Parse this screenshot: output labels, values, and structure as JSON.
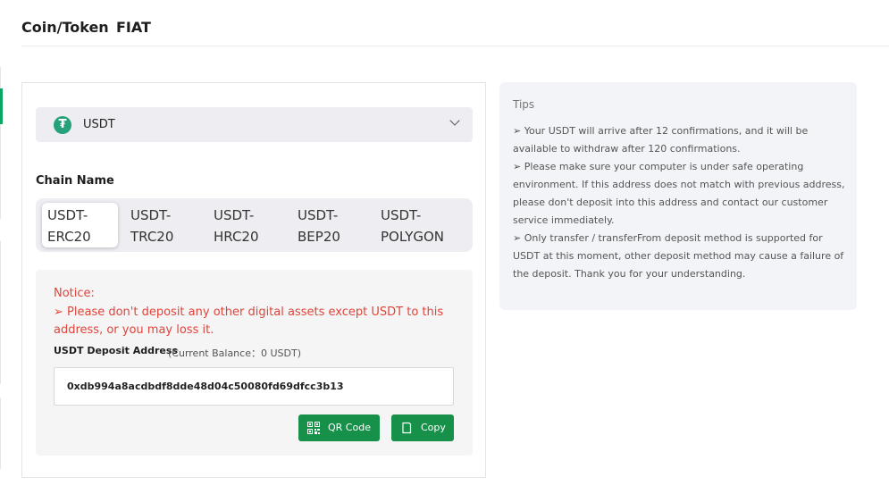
{
  "tabs": {
    "coin": "Coin/Token",
    "fiat": "FIAT"
  },
  "coin": {
    "name": "USDT",
    "icon": "tether-icon",
    "icon_glyph": "₮",
    "icon_color": "#26a17b"
  },
  "chain": {
    "label": "Chain Name",
    "options": [
      {
        "line1": "USDT-",
        "line2": "ERC20"
      },
      {
        "line1": "USDT-",
        "line2": "TRC20"
      },
      {
        "line1": "USDT-",
        "line2": "HRC20"
      },
      {
        "line1": "USDT-",
        "line2": "BEP20"
      },
      {
        "line1": "USDT-",
        "line2": "POLYGON"
      }
    ],
    "selected": "USDT-ERC20"
  },
  "notice": {
    "title": "Notice:",
    "text": "➢ Please don't deposit any other digital assets except USDT to this address, or you may loss it."
  },
  "deposit": {
    "label": "USDT Deposit Address",
    "balance": "(Current Balance：0 USDT)",
    "address": "0xdb994a8acdbdf8dde48d04c50080fd69dfcc3b13"
  },
  "buttons": {
    "qr": "QR Code",
    "copy": "Copy"
  },
  "tips": {
    "title": "Tips",
    "lines": [
      "➢ Your USDT will arrive after 12 confirmations, and it will be available to withdraw after 120 confirmations.",
      "➢ Please make sure your computer is under safe operating environment. If this address does not match with previous address, please don't deposit into this address and contact our customer service immediately.",
      "➢ Only transfer / transferFrom deposit method is supported for USDT at this moment, other deposit method may cause a failure of the deposit. Thank you for your understanding."
    ]
  },
  "colors": {
    "accent": "#17904a",
    "warning": "#e0443a",
    "active_rail": "#0aa561"
  }
}
